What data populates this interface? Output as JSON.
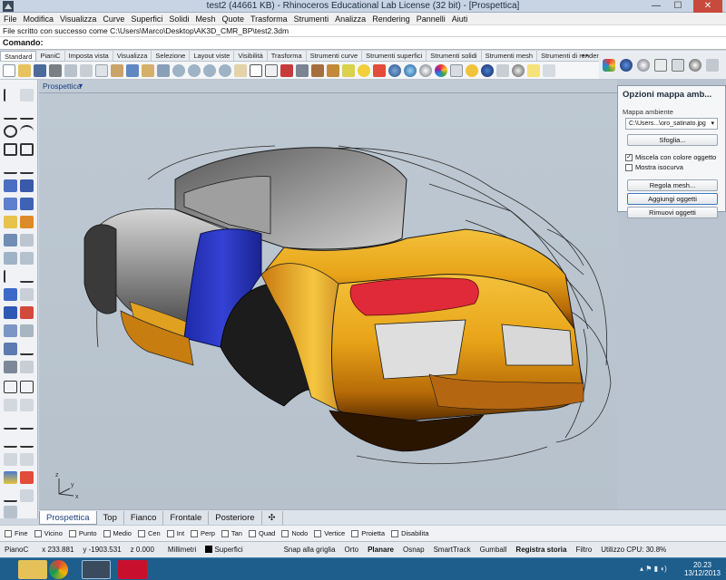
{
  "window": {
    "title": "test2 (44661 KB) - Rhinoceros Educational Lab License (32 bit) - [Prospettica]",
    "min_glyph": "—",
    "max_glyph": "☐",
    "close_glyph": "✕"
  },
  "menu": [
    "File",
    "Modifica",
    "Visualizza",
    "Curve",
    "Superfici",
    "Solidi",
    "Mesh",
    "Quote",
    "Trasforma",
    "Strumenti",
    "Analizza",
    "Rendering",
    "Pannelli",
    "Aiuti"
  ],
  "command": {
    "history": "File scritto con successo come C:\\Users\\Marco\\Desktop\\AK3D_CMR_BP\\test2.3dm",
    "prompt": "Comando:"
  },
  "toolbar_tabs": [
    "Standard",
    "PianiC",
    "Imposta vista",
    "Visualizza",
    "Selezione",
    "Layout viste",
    "Visibilità",
    "Trasforma",
    "Strumenti curve",
    "Strumenti superfici",
    "Strumenti solidi",
    "Strumenti mesh",
    "Strumenti di renderin"
  ],
  "tab_nav": "◂ ▸",
  "viewport": {
    "title": "Prospettica",
    "dropdown": "▾",
    "axis_z": "z",
    "axis_y": "y",
    "axis_x": "x"
  },
  "panel": {
    "title": "Opzioni mappa amb...",
    "section_label": "Mappa ambiente",
    "map_value": "C:\\Users...\\oro_satinato.jpg",
    "browse_button": "Sfoglia...",
    "blend_label": "Miscela con colore oggetto",
    "blend_checked": true,
    "backface_label": "Mostra isocurva",
    "backface_checked": false,
    "adjust_mesh_button": "Regola mesh...",
    "add_objects_button": "Aggiungi oggetti",
    "remove_objects_button": "Rimuovi oggetti"
  },
  "viewport_tabs": [
    "Prospettica",
    "Top",
    "Fianco",
    "Frontale",
    "Posteriore"
  ],
  "viewport_tab_add": "✣",
  "osnaps": [
    "Fine",
    "Vicino",
    "Punto",
    "Medio",
    "Cen",
    "Int",
    "Perp",
    "Tan",
    "Quad",
    "Nodo",
    "Vertice",
    "Proietta",
    "Disabilita"
  ],
  "status": {
    "plane": "PianoC",
    "x": "x 233.881",
    "y": "y -1903.531",
    "z": "z 0.000",
    "units": "Millimetri",
    "layer": "Superfici",
    "snap": "Snap alla griglia",
    "ortho": "Orto",
    "planar": "Planare",
    "osnap": "Osnap",
    "smarttrack": "SmartTrack",
    "gumball": "Gumball",
    "history": "Registra storia",
    "filter": "Filtro",
    "cpu": "Utilizzo CPU: 30.8%"
  },
  "clock": {
    "time": "20.23",
    "date": "13/12/2013"
  },
  "colors": {
    "gold": "#e8a418",
    "blue_panel": "#2f3fc6",
    "red_light": "#e02a39",
    "body_gray": "#8f8f8f"
  },
  "icons": [
    "new-file-icon",
    "open-file-icon",
    "save-icon",
    "print-icon",
    "cut-icon",
    "copy-icon",
    "paste-icon",
    "undo-icon",
    "pan-icon",
    "rotate-view-icon",
    "zoom-icon",
    "zoom-window-icon",
    "zoom-extents-icon",
    "grid-icon",
    "render-icon",
    "material-icon",
    "sphere-icon",
    "lights-icon",
    "layer-icon"
  ]
}
